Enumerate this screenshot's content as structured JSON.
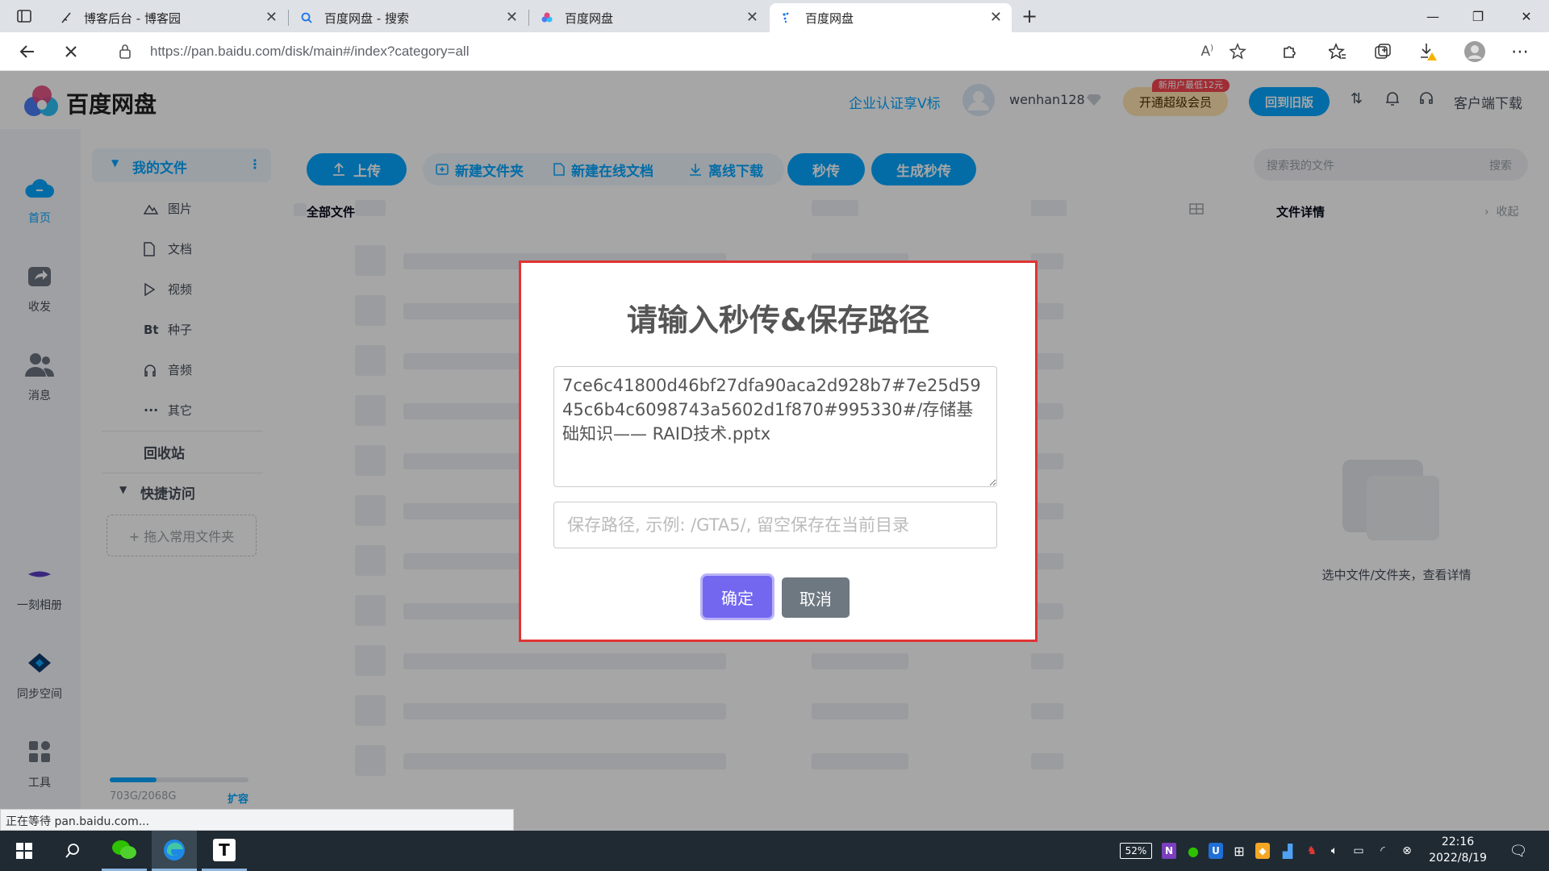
{
  "browser": {
    "tabs": [
      {
        "title": "博客后台 - 博客园",
        "icon": "quill-icon"
      },
      {
        "title": "百度网盘 - 搜索",
        "icon": "search-icon"
      },
      {
        "title": "百度网盘",
        "icon": "baidu-cloud-icon"
      },
      {
        "title": "百度网盘",
        "icon": "loading-icon"
      }
    ],
    "new_tab": "+",
    "url": "https://pan.baidu.com/disk/main#/index?category=all"
  },
  "header": {
    "logo_text": "百度网盘",
    "enterprise": "企业认证享V标",
    "username": "wenhan128",
    "vip_badge": "新用户最低12元",
    "vip_button": "开通超级会员",
    "old_version": "回到旧版",
    "client_download": "客户端下载"
  },
  "left_nav": [
    {
      "label": "首页",
      "icon": "cloud-home-icon"
    },
    {
      "label": "收发",
      "icon": "share-icon"
    },
    {
      "label": "消息",
      "icon": "people-icon"
    },
    {
      "label": "一刻相册",
      "icon": "album-icon"
    },
    {
      "label": "同步空间",
      "icon": "sync-icon"
    },
    {
      "label": "工具",
      "icon": "tools-icon"
    }
  ],
  "sidebar": {
    "my_files": "我的文件",
    "items": [
      {
        "label": "图片",
        "icon": "picture-icon"
      },
      {
        "label": "文档",
        "icon": "document-icon"
      },
      {
        "label": "视频",
        "icon": "play-icon"
      },
      {
        "label": "种子",
        "icon": "Bt"
      },
      {
        "label": "音频",
        "icon": "headphone-icon"
      },
      {
        "label": "其它",
        "icon": "more-icon"
      }
    ],
    "recycle": "回收站",
    "quick_access": "快捷访问",
    "drop_hint": "+ 拖入常用文件夹",
    "storage_used": "703G/2068G",
    "storage_fraction": 0.34,
    "expand": "扩容"
  },
  "toolbar": {
    "upload": "上传",
    "new_folder": "新建文件夹",
    "new_doc": "新建在线文档",
    "offline": "离线下载",
    "rapid": "秒传",
    "gen_rapid": "生成秒传"
  },
  "main": {
    "breadcrumb": "全部文件"
  },
  "search": {
    "placeholder": "搜索我的文件",
    "button": "搜索"
  },
  "detail": {
    "title": "文件详情",
    "collapse": "收起",
    "empty_hint": "选中文件/文件夹，查看详情"
  },
  "dialog": {
    "title": "请输入秒传&保存路径",
    "link_value": "7ce6c41800d46bf27dfa90aca2d928b7#7e25d5945c6b4c6098743a5602d1f870#995330#/存储基础知识—— RAID技术.pptx",
    "path_placeholder": "保存路径, 示例: /GTA5/, 留空保存在当前目录",
    "ok": "确定",
    "cancel": "取消"
  },
  "status_text": "正在等待 pan.baidu.com...",
  "taskbar": {
    "battery": "52%",
    "time": "22:16",
    "date": "2022/8/19"
  }
}
